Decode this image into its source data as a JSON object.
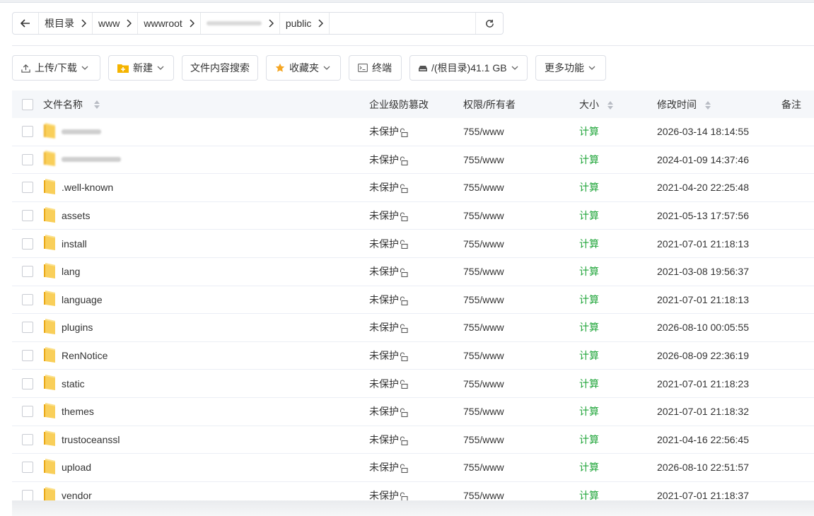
{
  "breadcrumb": {
    "items": [
      "根目录",
      "www",
      "wwwroot",
      "",
      "public"
    ]
  },
  "toolbar": {
    "upload_label": "上传/下载",
    "new_label": "新建",
    "search_content_label": "文件内容搜索",
    "favorites_label": "收藏夹",
    "terminal_label": "终端",
    "disk_label": "/(根目录)41.1 GB",
    "more_label": "更多功能"
  },
  "table": {
    "headers": {
      "name": "文件名称",
      "protect": "企业级防篡改",
      "perm": "权限/所有者",
      "size": "大小",
      "mtime": "修改时间",
      "note": "备注"
    },
    "rows": [
      {
        "name": "",
        "protect": "未保护",
        "perm": "755/www",
        "size": "计算",
        "mtime": "2026-03-14 18:14:55"
      },
      {
        "name": "",
        "protect": "未保护",
        "perm": "755/www",
        "size": "计算",
        "mtime": "2024-01-09 14:37:46"
      },
      {
        "name": ".well-known",
        "protect": "未保护",
        "perm": "755/www",
        "size": "计算",
        "mtime": "2021-04-20 22:25:48"
      },
      {
        "name": "assets",
        "protect": "未保护",
        "perm": "755/www",
        "size": "计算",
        "mtime": "2021-05-13 17:57:56"
      },
      {
        "name": "install",
        "protect": "未保护",
        "perm": "755/www",
        "size": "计算",
        "mtime": "2021-07-01 21:18:13"
      },
      {
        "name": "lang",
        "protect": "未保护",
        "perm": "755/www",
        "size": "计算",
        "mtime": "2021-03-08 19:56:37"
      },
      {
        "name": "language",
        "protect": "未保护",
        "perm": "755/www",
        "size": "计算",
        "mtime": "2021-07-01 21:18:13"
      },
      {
        "name": "plugins",
        "protect": "未保护",
        "perm": "755/www",
        "size": "计算",
        "mtime": "2026-08-10 00:05:55"
      },
      {
        "name": "RenNotice",
        "protect": "未保护",
        "perm": "755/www",
        "size": "计算",
        "mtime": "2026-08-09 22:36:19"
      },
      {
        "name": "static",
        "protect": "未保护",
        "perm": "755/www",
        "size": "计算",
        "mtime": "2021-07-01 21:18:23"
      },
      {
        "name": "themes",
        "protect": "未保护",
        "perm": "755/www",
        "size": "计算",
        "mtime": "2021-07-01 21:18:32"
      },
      {
        "name": "trustoceanssl",
        "protect": "未保护",
        "perm": "755/www",
        "size": "计算",
        "mtime": "2021-04-16 22:56:45"
      },
      {
        "name": "upload",
        "protect": "未保护",
        "perm": "755/www",
        "size": "计算",
        "mtime": "2026-08-10 22:51:57"
      },
      {
        "name": "vendor",
        "protect": "未保护",
        "perm": "755/www",
        "size": "计算",
        "mtime": "2021-07-01 21:18:37"
      }
    ]
  },
  "colors": {
    "accent_green": "#20a53a",
    "folder_yellow": "#f5c242",
    "header_bg": "#f5f7fa"
  },
  "icons": [
    "back-arrow-icon",
    "chevron-right-icon",
    "refresh-icon",
    "upload-icon",
    "new-folder-icon",
    "star-icon",
    "terminal-icon",
    "disk-icon",
    "chevron-down-icon",
    "sort-icon",
    "folder-icon",
    "lock-icon"
  ]
}
